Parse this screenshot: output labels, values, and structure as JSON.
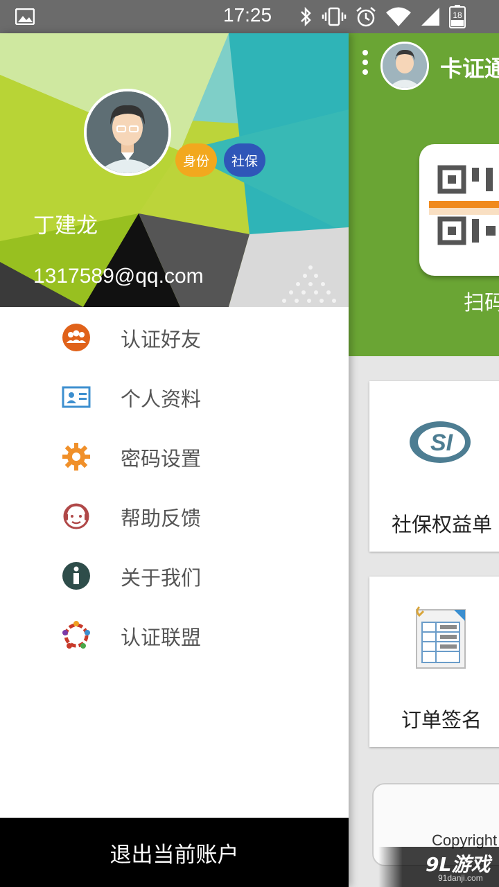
{
  "status_bar": {
    "time": "17:25",
    "battery": "18",
    "icons": [
      "image-icon",
      "bluetooth-icon",
      "vibrate-icon",
      "alarm-icon",
      "wifi-icon",
      "signal-icon",
      "battery-icon"
    ]
  },
  "drawer": {
    "user_name": "丁建龙",
    "user_email": "1317589@qq.com",
    "badges": {
      "id": "身份",
      "social": "社保"
    },
    "menu": [
      {
        "label": "认证好友",
        "icon": "friends-icon",
        "color": "#e0621a"
      },
      {
        "label": "个人资料",
        "icon": "id-card-icon",
        "color": "#3d8fcf"
      },
      {
        "label": "密码设置",
        "icon": "gear-icon",
        "color": "#f0902a"
      },
      {
        "label": "帮助反馈",
        "icon": "support-agent-icon",
        "color": "#b04848"
      },
      {
        "label": "关于我们",
        "icon": "info-icon",
        "color": "#2e4d4a"
      },
      {
        "label": "认证联盟",
        "icon": "alliance-icon",
        "color": "#c83a2a"
      }
    ],
    "logout_label": "退出当前账户"
  },
  "app": {
    "title": "卡证通",
    "scan_label": "扫码",
    "cards": [
      {
        "label": "社保权益单",
        "icon": "si-logo-icon"
      },
      {
        "label": "订单签名",
        "icon": "document-table-icon"
      }
    ],
    "copyright": "Copyright",
    "header_color": "#6aa534"
  },
  "watermark": {
    "text": "9L游戏",
    "sub": "91danji.com"
  }
}
